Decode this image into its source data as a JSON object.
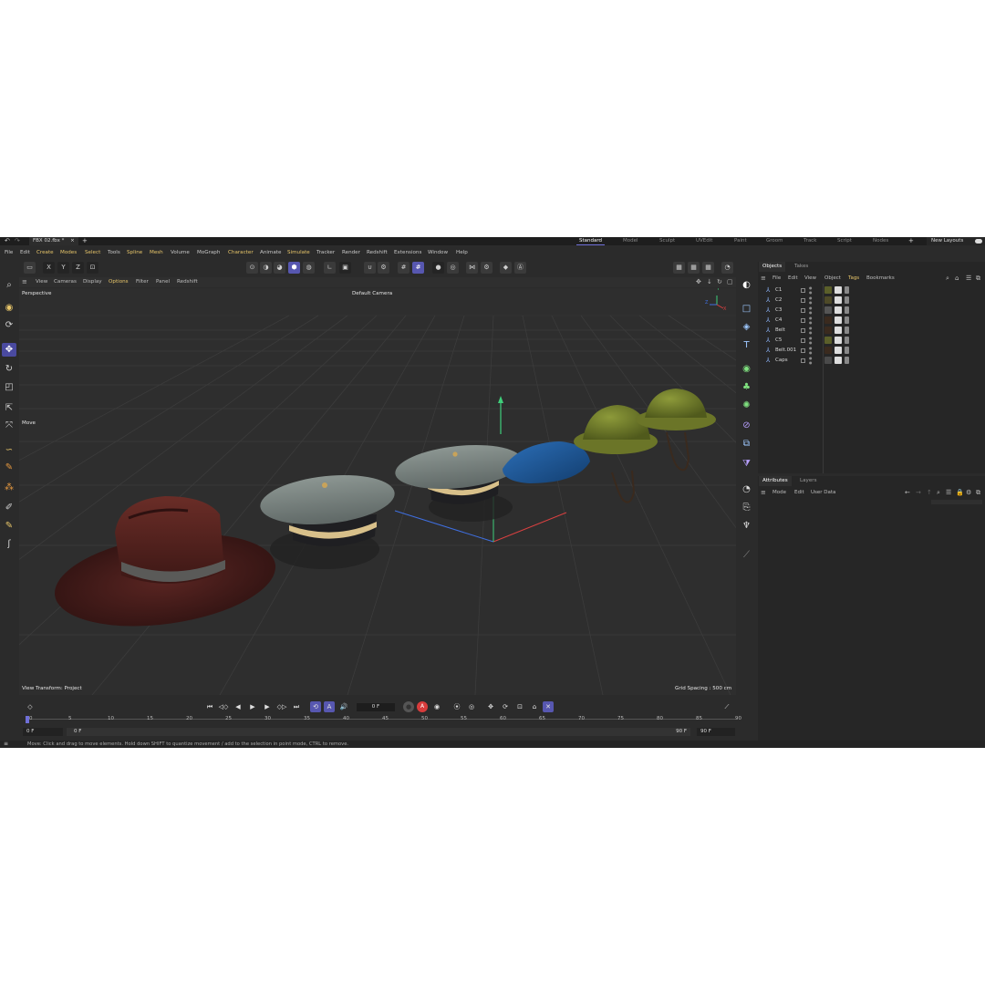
{
  "title_bar": {
    "file_tab": "FBX 02.fbx *",
    "close_glyph": "×",
    "add_glyph": "+",
    "layouts": [
      "Standard",
      "Model",
      "Sculpt",
      "UVEdit",
      "Paint",
      "Groom",
      "Track",
      "Script",
      "Nodes"
    ],
    "active_layout": "Standard",
    "new_layouts": "New Layouts"
  },
  "menu": [
    "File",
    "Edit",
    "Create",
    "Modes",
    "Select",
    "Tools",
    "Spline",
    "Mesh",
    "Volume",
    "MoGraph",
    "Character",
    "Animate",
    "Simulate",
    "Tracker",
    "Render",
    "Redshift",
    "Extensions",
    "Window",
    "Help"
  ],
  "menu_highlight": [
    "Create",
    "Modes",
    "Select",
    "Spline",
    "Mesh",
    "Character",
    "Simulate"
  ],
  "toolbar": {
    "x": "X",
    "y": "Y",
    "z": "Z"
  },
  "viewport": {
    "menu": [
      "View",
      "Cameras",
      "Display",
      "Options",
      "Filter",
      "Panel",
      "Redshift"
    ],
    "menu_highlight": "Options",
    "projection": "Perspective",
    "camera": "Default Camera",
    "tool_label": "Move",
    "view_transform": "View Transform: Project",
    "grid_spacing": "Grid Spacing : 500 cm",
    "axis_labels": {
      "y": "Y",
      "z": "Z",
      "x": "X"
    }
  },
  "timeline": {
    "current_frame": "0 F",
    "start_frame": "0 F",
    "start_frame2": "0 F",
    "end_frame": "90 F",
    "end_frame2": "90 F",
    "ruler": [
      "0",
      "5",
      "10",
      "15",
      "20",
      "25",
      "30",
      "35",
      "40",
      "45",
      "50",
      "55",
      "60",
      "65",
      "70",
      "75",
      "80",
      "85",
      "90"
    ]
  },
  "status_text": "Move: Click and drag to move elements. Hold down SHIFT to quantize movement / add to the selection in point mode, CTRL to remove.",
  "objects_panel": {
    "tabs": [
      "Objects",
      "Takes"
    ],
    "menu": [
      "File",
      "Edit",
      "View",
      "Object",
      "Tags",
      "Bookmarks"
    ],
    "menu_highlight": "Tags",
    "objects": [
      "C1",
      "C2",
      "C3",
      "C4",
      "Belt",
      "C5",
      "Belt.001",
      "Caps"
    ]
  },
  "attributes_panel": {
    "tabs": [
      "Attributes",
      "Layers"
    ],
    "menu": [
      "Mode",
      "Edit",
      "User Data"
    ]
  },
  "colors": {
    "accent": "#5757b0",
    "highlight_text": "#e8c66a",
    "viewport_bg": "#2e2e2e",
    "axis_x": "#d84040",
    "axis_y": "#3fcf7a",
    "axis_z": "#3f6fe0"
  },
  "icons": {
    "left_palette": [
      "search-icon",
      "view-icon",
      "transform-icon",
      "move-icon",
      "rotate-icon",
      "scale-icon",
      "snap-icon",
      "select-icon",
      "spline-pen-icon",
      "polygon-pen-icon",
      "weight-icon",
      "brush-icon",
      "knife-icon",
      "magnet-icon"
    ],
    "right_palette": [
      "circle-icon",
      "cube-outline-icon",
      "cube-icon",
      "text-icon",
      "generator-icon",
      "cloner-icon",
      "effector-icon",
      "deformer-icon",
      "spline-deform-icon",
      "field-icon",
      "environment-icon",
      "camera-icon",
      "light-icon",
      "python-icon"
    ]
  }
}
